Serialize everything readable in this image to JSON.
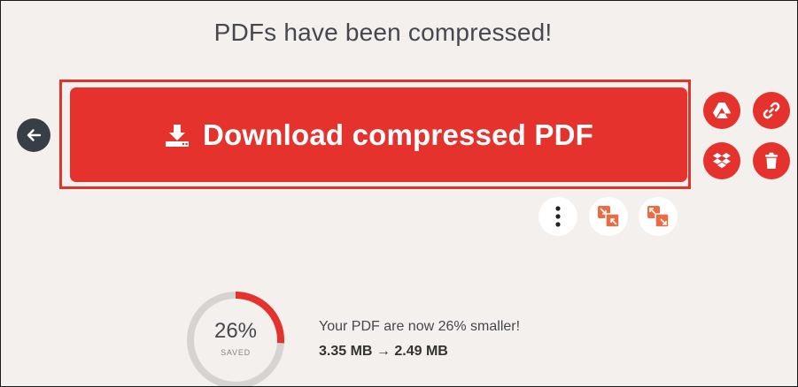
{
  "header": {
    "title": "PDFs have been compressed!"
  },
  "actions": {
    "download_label": "Download compressed PDF",
    "back_icon": "arrow-left-icon",
    "download_icon": "download-icon",
    "side_icons": [
      "google-drive-icon",
      "link-icon",
      "dropbox-icon",
      "trash-icon"
    ],
    "tool_icons": [
      "more-vertical-icon",
      "compress-icon",
      "expand-icon"
    ]
  },
  "result": {
    "percent": "26%",
    "percent_value": 0.26,
    "saved_label": "SAVED",
    "message": "Your PDF are now 26% smaller!",
    "size_before": "3.35 MB",
    "arrow": "→",
    "size_after": "2.49 MB"
  },
  "colors": {
    "brand_red": "#e5322d",
    "tool_orange": "#ed6b42",
    "back_dark": "#383e45",
    "background": "#f3f0ed",
    "ring_track": "#d6d4d2"
  }
}
